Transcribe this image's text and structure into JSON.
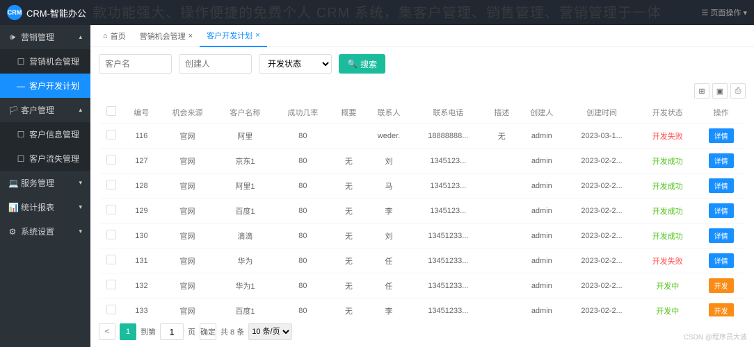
{
  "watermark": "款功能强大、操作便捷的免费个人 CRM 系统，集客户管理、销售管理、营销管理于一体",
  "header": {
    "logo": "CRM",
    "brand": "CRM-智能办公",
    "page_op": "页面操作 ▾"
  },
  "sidebar": {
    "groups": [
      {
        "icon": "🕪",
        "label": "营销管理",
        "caret": "▴",
        "sub": [
          {
            "label": "营销机会管理",
            "active": false
          },
          {
            "label": "客户开发计划",
            "active": true
          }
        ]
      },
      {
        "icon": "🏳",
        "label": "客户管理",
        "caret": "▴",
        "sub": [
          {
            "label": "客户信息管理",
            "active": false
          },
          {
            "label": "客户流失管理",
            "active": false
          }
        ]
      },
      {
        "icon": "💻",
        "label": "服务管理",
        "caret": "▾"
      },
      {
        "icon": "📊",
        "label": "统计报表",
        "caret": "▾"
      },
      {
        "icon": "⚙",
        "label": "系统设置",
        "caret": "▾"
      }
    ]
  },
  "tabs": [
    {
      "icon": "⌂",
      "label": "首页",
      "close": false
    },
    {
      "icon": "",
      "label": "营销机会管理",
      "close": true
    },
    {
      "icon": "",
      "label": "客户开发计划",
      "close": true,
      "active": true
    }
  ],
  "search": {
    "name_ph": "客户名",
    "creator_ph": "创建人",
    "status_ph": "开发状态",
    "btn": "搜索"
  },
  "table": {
    "headers": [
      "编号",
      "机会来源",
      "客户名称",
      "成功几率",
      "概要",
      "联系人",
      "联系电话",
      "描述",
      "创建人",
      "创建时间",
      "开发状态",
      "操作"
    ],
    "rows": [
      {
        "id": "116",
        "src": "官网",
        "cust": "阿里",
        "rate": "80",
        "sum": "",
        "contact": "weder.",
        "phone": "18888888...",
        "desc": "无",
        "creator": "admin",
        "time": "2023-03-1...",
        "status": "开发失败",
        "status_cls": "status-fail",
        "btn": "详情",
        "btn_cls": "btn-detail"
      },
      {
        "id": "127",
        "src": "官网",
        "cust": "京东1",
        "rate": "80",
        "sum": "无",
        "contact": "刘",
        "phone": "1345123...",
        "desc": "",
        "creator": "admin",
        "time": "2023-02-2...",
        "status": "开发成功",
        "status_cls": "status-ok",
        "btn": "详情",
        "btn_cls": "btn-detail"
      },
      {
        "id": "128",
        "src": "官网",
        "cust": "阿里1",
        "rate": "80",
        "sum": "无",
        "contact": "马",
        "phone": "1345123...",
        "desc": "",
        "creator": "admin",
        "time": "2023-02-2...",
        "status": "开发成功",
        "status_cls": "status-ok",
        "btn": "详情",
        "btn_cls": "btn-detail"
      },
      {
        "id": "129",
        "src": "官网",
        "cust": "百度1",
        "rate": "80",
        "sum": "无",
        "contact": "李",
        "phone": "1345123...",
        "desc": "",
        "creator": "admin",
        "time": "2023-02-2...",
        "status": "开发成功",
        "status_cls": "status-ok",
        "btn": "详情",
        "btn_cls": "btn-detail"
      },
      {
        "id": "130",
        "src": "官网",
        "cust": "滴滴",
        "rate": "80",
        "sum": "无",
        "contact": "刘",
        "phone": "13451233...",
        "desc": "",
        "creator": "admin",
        "time": "2023-02-2...",
        "status": "开发成功",
        "status_cls": "status-ok",
        "btn": "详情",
        "btn_cls": "btn-detail"
      },
      {
        "id": "131",
        "src": "官网",
        "cust": "华为",
        "rate": "80",
        "sum": "无",
        "contact": "任",
        "phone": "13451233...",
        "desc": "",
        "creator": "admin",
        "time": "2023-02-2...",
        "status": "开发失败",
        "status_cls": "status-fail",
        "btn": "详情",
        "btn_cls": "btn-detail"
      },
      {
        "id": "132",
        "src": "官网",
        "cust": "华为1",
        "rate": "80",
        "sum": "无",
        "contact": "任",
        "phone": "13451233...",
        "desc": "",
        "creator": "admin",
        "time": "2023-02-2...",
        "status": "开发中",
        "status_cls": "status-ing",
        "btn": "开发",
        "btn_cls": "btn-open"
      },
      {
        "id": "133",
        "src": "官网",
        "cust": "百度1",
        "rate": "80",
        "sum": "无",
        "contact": "李",
        "phone": "13451233...",
        "desc": "",
        "creator": "admin",
        "time": "2023-02-2...",
        "status": "开发中",
        "status_cls": "status-ing",
        "btn": "开发",
        "btn_cls": "btn-open"
      }
    ]
  },
  "pager": {
    "prev": "<",
    "cur": "1",
    "to": "到第",
    "page_in": "1",
    "page_lbl": "页",
    "confirm": "确定",
    "total": "共 8 条",
    "per": "10 条/页"
  },
  "csdn": "CSDN @程序员大波"
}
